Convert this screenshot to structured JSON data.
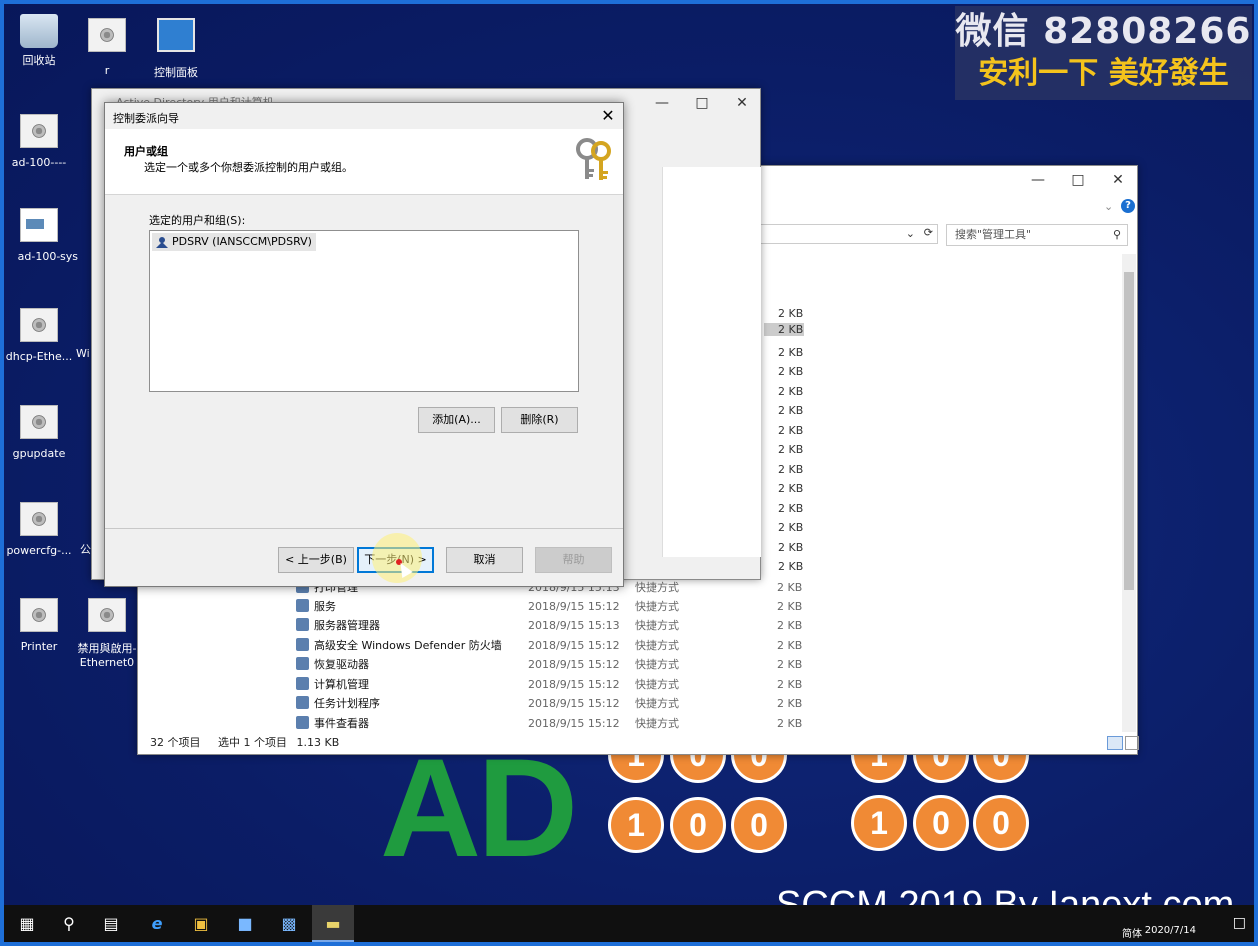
{
  "desktop": {
    "icons": [
      {
        "label": "回收站",
        "icon": "recycle-bin-icon"
      },
      {
        "label": "r",
        "icon": "settings-file-icon"
      },
      {
        "label": "控制面板",
        "icon": "control-panel-icon"
      },
      {
        "label": "ad-100----",
        "icon": "settings-file-icon"
      },
      {
        "label": "ad-100-",
        "icon": "image-file-icon"
      },
      {
        "label": "sys",
        "icon": "settings-file-icon"
      },
      {
        "label": "dhcp-Ethe...",
        "icon": "settings-file-icon"
      },
      {
        "label": "Wi",
        "icon": "settings-file-icon"
      },
      {
        "label": "gpupdate",
        "icon": "settings-file-icon"
      },
      {
        "label": "powercfg-...",
        "icon": "settings-file-icon"
      },
      {
        "label": "公",
        "icon": "settings-file-icon"
      },
      {
        "label": "Printer",
        "icon": "settings-file-icon"
      },
      {
        "label": "禁用與啟用-Ethernet0",
        "icon": "settings-file-icon"
      }
    ],
    "watermark": {
      "line1": "微信 82808266",
      "line2": "安利一下 美好發生"
    },
    "logo_text": "AD",
    "balls_top": [
      "1",
      "0",
      "0",
      "1",
      "0",
      "0"
    ],
    "balls_bottom": [
      "1",
      "0",
      "0",
      "1",
      "0",
      "0"
    ],
    "brand": "SCCM 2019 By Ianext.com"
  },
  "aduc_window": {
    "title": "Active Directory 用户和计算机"
  },
  "explorer": {
    "search_placeholder": "搜索\"管理工具\"",
    "sizes_above": [
      "2 KB",
      "2 KB",
      "2 KB",
      "2 KB",
      "2 KB",
      "2 KB",
      "2 KB",
      "2 KB",
      "2 KB",
      "2 KB",
      "2 KB",
      "2 KB",
      "2 KB",
      "2 KB"
    ],
    "rows": [
      {
        "name": "打印管理",
        "date": "2018/9/15 15:13",
        "type": "快捷方式",
        "size": "2 KB"
      },
      {
        "name": "服务",
        "date": "2018/9/15 15:12",
        "type": "快捷方式",
        "size": "2 KB"
      },
      {
        "name": "服务器管理器",
        "date": "2018/9/15 15:13",
        "type": "快捷方式",
        "size": "2 KB"
      },
      {
        "name": "高级安全 Windows Defender 防火墙",
        "date": "2018/9/15 15:12",
        "type": "快捷方式",
        "size": "2 KB"
      },
      {
        "name": "恢复驱动器",
        "date": "2018/9/15 15:12",
        "type": "快捷方式",
        "size": "2 KB"
      },
      {
        "name": "计算机管理",
        "date": "2018/9/15 15:12",
        "type": "快捷方式",
        "size": "2 KB"
      },
      {
        "name": "任务计划程序",
        "date": "2018/9/15 15:12",
        "type": "快捷方式",
        "size": "2 KB"
      },
      {
        "name": "事件查看器",
        "date": "2018/9/15 15:12",
        "type": "快捷方式",
        "size": "2 KB"
      }
    ],
    "status": {
      "count": "32 个项目",
      "selected": "选中 1 个项目",
      "size": "1.13 KB"
    }
  },
  "dialog": {
    "title": "控制委派向导",
    "header_title": "用户或组",
    "header_subtitle": "选定一个或多个你想委派控制的用户或组。",
    "list_label": "选定的用户和组(S):",
    "selected_item": "PDSRV (IANSCCM\\PDSRV)",
    "add_button": "添加(A)...",
    "remove_button": "删除(R)",
    "back_button": "< 上一步(B)",
    "next_button": "下一步(N) >",
    "cancel_button": "取消",
    "help_button": "帮助"
  },
  "taskbar": {
    "date": "2020/7/14",
    "ime": "简体"
  }
}
